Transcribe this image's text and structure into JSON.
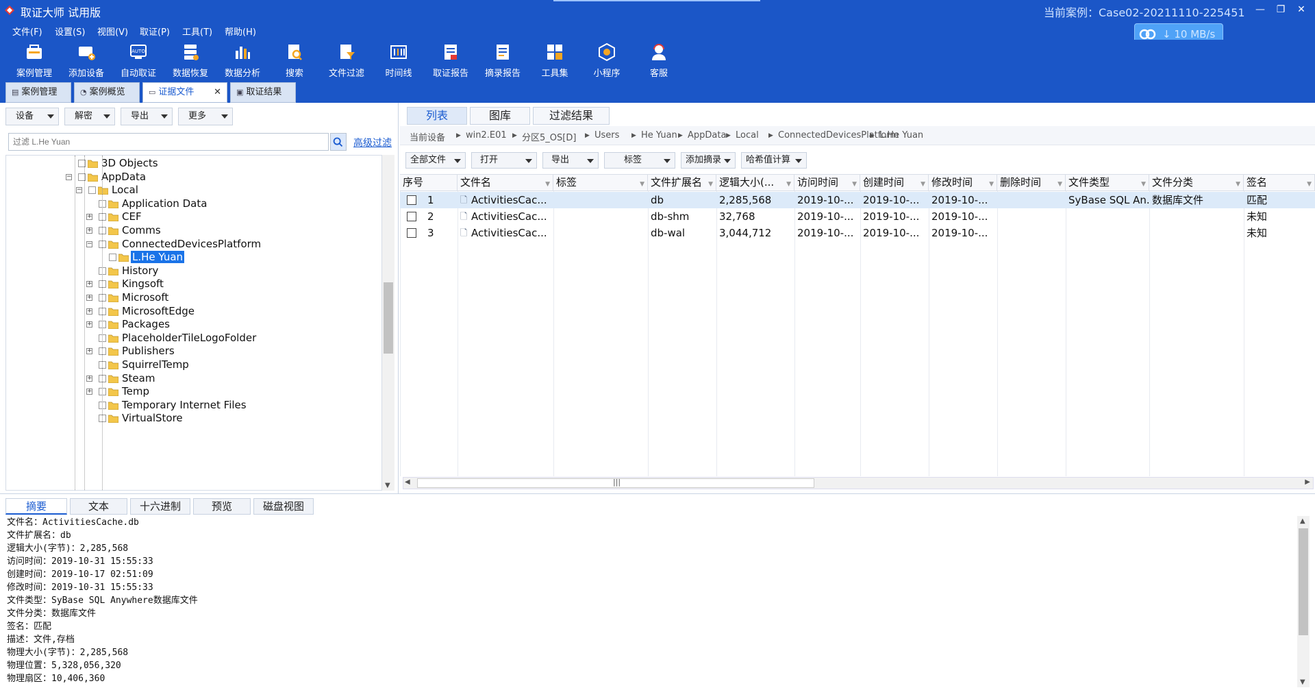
{
  "title": {
    "app": "取证大师 试用版",
    "case": "当前案例：Case02-20211110-225451"
  },
  "window_buttons": [
    "—",
    "❐",
    "✕"
  ],
  "menu": [
    "文件(F)",
    "设置(S)",
    "视图(V)",
    "取证(P)",
    "工具(T)",
    "帮助(H)"
  ],
  "speed": "10 MB/s",
  "toolbar": [
    {
      "label": "案例管理",
      "icon": "case-manage-icon"
    },
    {
      "label": "添加设备",
      "icon": "add-device-icon"
    },
    {
      "label": "自动取证",
      "icon": "auto-forensics-icon"
    },
    {
      "label": "数据恢复",
      "icon": "data-recovery-icon"
    },
    {
      "label": "数据分析",
      "icon": "data-analysis-icon"
    },
    {
      "label": "搜索",
      "icon": "search-doc-icon"
    },
    {
      "label": "文件过滤",
      "icon": "file-filter-icon"
    },
    {
      "label": "时间线",
      "icon": "timeline-icon"
    },
    {
      "label": "取证报告",
      "icon": "report-icon"
    },
    {
      "label": "摘录报告",
      "icon": "excerpt-report-icon"
    },
    {
      "label": "工具集",
      "icon": "toolkit-icon"
    },
    {
      "label": "小程序",
      "icon": "mini-program-icon"
    },
    {
      "label": "客服",
      "icon": "support-icon"
    }
  ],
  "doc_tabs": [
    {
      "label": "案例管理"
    },
    {
      "label": "案例概览"
    },
    {
      "label": "证据文件"
    },
    {
      "label": "取证结果"
    }
  ],
  "left": {
    "dropdowns": [
      "设备",
      "解密",
      "导出",
      "更多"
    ],
    "filter_placeholder": "过滤 L.He Yuan",
    "advanced_filter": "高级过滤",
    "tree": [
      {
        "label": "3D Objects",
        "level": 1,
        "exp": "none"
      },
      {
        "label": "AppData",
        "level": 1,
        "exp": "minus"
      },
      {
        "label": "Local",
        "level": 2,
        "exp": "minus"
      },
      {
        "label": "Application Data",
        "level": 3,
        "exp": "none"
      },
      {
        "label": "CEF",
        "level": 3,
        "exp": "plus"
      },
      {
        "label": "Comms",
        "level": 3,
        "exp": "plus"
      },
      {
        "label": "ConnectedDevicesPlatform",
        "level": 3,
        "exp": "minus"
      },
      {
        "label": "L.He Yuan",
        "level": 4,
        "exp": "none",
        "selected": true
      },
      {
        "label": "History",
        "level": 3,
        "exp": "none"
      },
      {
        "label": "Kingsoft",
        "level": 3,
        "exp": "plus"
      },
      {
        "label": "Microsoft",
        "level": 3,
        "exp": "plus"
      },
      {
        "label": "MicrosoftEdge",
        "level": 3,
        "exp": "plus"
      },
      {
        "label": "Packages",
        "level": 3,
        "exp": "plus"
      },
      {
        "label": "PlaceholderTileLogoFolder",
        "level": 3,
        "exp": "none"
      },
      {
        "label": "Publishers",
        "level": 3,
        "exp": "plus"
      },
      {
        "label": "SquirrelTemp",
        "level": 3,
        "exp": "none"
      },
      {
        "label": "Steam",
        "level": 3,
        "exp": "plus"
      },
      {
        "label": "Temp",
        "level": 3,
        "exp": "plus"
      },
      {
        "label": "Temporary Internet Files",
        "level": 3,
        "exp": "none"
      },
      {
        "label": "VirtualStore",
        "level": 3,
        "exp": "none"
      }
    ]
  },
  "right": {
    "tabs": [
      "列表",
      "图库",
      "过滤结果"
    ],
    "breadcrumb": [
      "当前设备",
      "win2.E01",
      "分区5_OS[D]",
      "Users",
      "He Yuan",
      "AppData",
      "Local",
      "ConnectedDevicesPlatform",
      "L.He Yuan"
    ],
    "file_toolbar": [
      "全部文件",
      "打开",
      "导出",
      "标签",
      "添加摘录",
      "哈希值计算"
    ],
    "columns": [
      "序号",
      "文件名",
      "标签",
      "文件扩展名",
      "逻辑大小(...",
      "访问时间",
      "创建时间",
      "修改时间",
      "删除时间",
      "文件类型",
      "文件分类",
      "签名"
    ],
    "rows": [
      [
        "1",
        "ActivitiesCac...",
        "",
        "db",
        "2,285,568",
        "2019-10-...",
        "2019-10-...",
        "2019-10-...",
        "",
        "SyBase SQL An...",
        "数据库文件",
        "匹配"
      ],
      [
        "2",
        "ActivitiesCac...",
        "",
        "db-shm",
        "32,768",
        "2019-10-...",
        "2019-10-...",
        "2019-10-...",
        "",
        "",
        "",
        "未知"
      ],
      [
        "3",
        "ActivitiesCac...",
        "",
        "db-wal",
        "3,044,712",
        "2019-10-...",
        "2019-10-...",
        "2019-10-...",
        "",
        "",
        "",
        "未知"
      ]
    ]
  },
  "bottom": {
    "tabs": [
      "摘要",
      "文本",
      "十六进制",
      "预览",
      "磁盘视图"
    ],
    "details": [
      "文件名：ActivitiesCache.db",
      "文件扩展名：db",
      "逻辑大小(字节)：2,285,568",
      "访问时间：2019-10-31 15:55:33",
      "创建时间：2019-10-17 02:51:09",
      "修改时间：2019-10-31 15:55:33",
      "文件类型：SyBase SQL Anywhere数据库文件",
      "文件分类：数据库文件",
      "签名：匹配",
      "描述：文件,存档",
      "物理大小(字节)：2,285,568",
      "物理位置：5,328,056,320",
      "物理扇区：10,406,360"
    ]
  },
  "colors": {
    "brand": "#1b56c7",
    "selection": "#1a73e8",
    "row_highlight": "#dceaf9"
  }
}
